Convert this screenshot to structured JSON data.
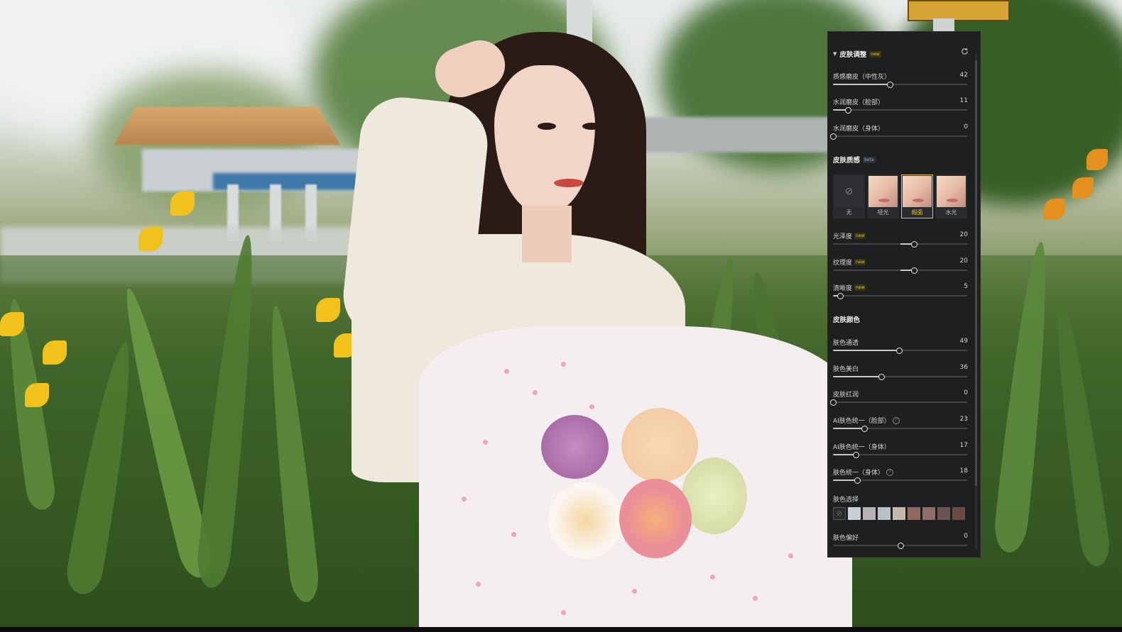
{
  "panel": {
    "skin_adjust": {
      "title": "皮肤调整",
      "tag": "new"
    },
    "sliders_top": [
      {
        "label": "质感磨皮（中性灰）",
        "value": "42",
        "level": 42
      },
      {
        "label": "水润磨皮（脸部）",
        "value": "11",
        "level": 11
      },
      {
        "label": "水润磨皮（身体）",
        "value": "0",
        "level": 0
      }
    ],
    "texture": {
      "title": "皮肤质感",
      "tag": "beta",
      "options": [
        {
          "label": "无",
          "selected": false
        },
        {
          "label": "哑光",
          "selected": false
        },
        {
          "label": "缎面",
          "selected": true
        },
        {
          "label": "水光",
          "selected": false
        }
      ]
    },
    "sliders_texture": [
      {
        "label": "光泽度",
        "tag": "new",
        "value": "20",
        "level": 20
      },
      {
        "label": "纹理度",
        "tag": "new",
        "value": "20",
        "level": 20
      },
      {
        "label": "清晰度",
        "tag": "new",
        "value": "5",
        "level": 5
      }
    ],
    "color": {
      "title": "皮肤颜色"
    },
    "sliders_color": [
      {
        "label": "肤色通透",
        "value": "49",
        "level": 49
      },
      {
        "label": "肤色美白",
        "value": "36",
        "level": 36
      },
      {
        "label": "皮肤红润",
        "value": "0",
        "level": 0
      },
      {
        "label": "AI肤色统一（脸部）",
        "value": "23",
        "level": 23,
        "help": true
      },
      {
        "label": "AI肤色统一（身体）",
        "value": "17",
        "level": 17
      },
      {
        "label": "肤色统一（身体）",
        "value": "18",
        "level": 18,
        "help": true
      }
    ],
    "swatches": {
      "title": "肤色选择",
      "colors": [
        "#c9cfd4",
        "#b9b3b6",
        "#b7c1c8",
        "#c2b8ab",
        "#8f6960",
        "#8e6e68",
        "#6b5553",
        "#6a4a44"
      ]
    },
    "preference": {
      "label": "肤色偏好",
      "value": "0",
      "level": 0
    }
  }
}
